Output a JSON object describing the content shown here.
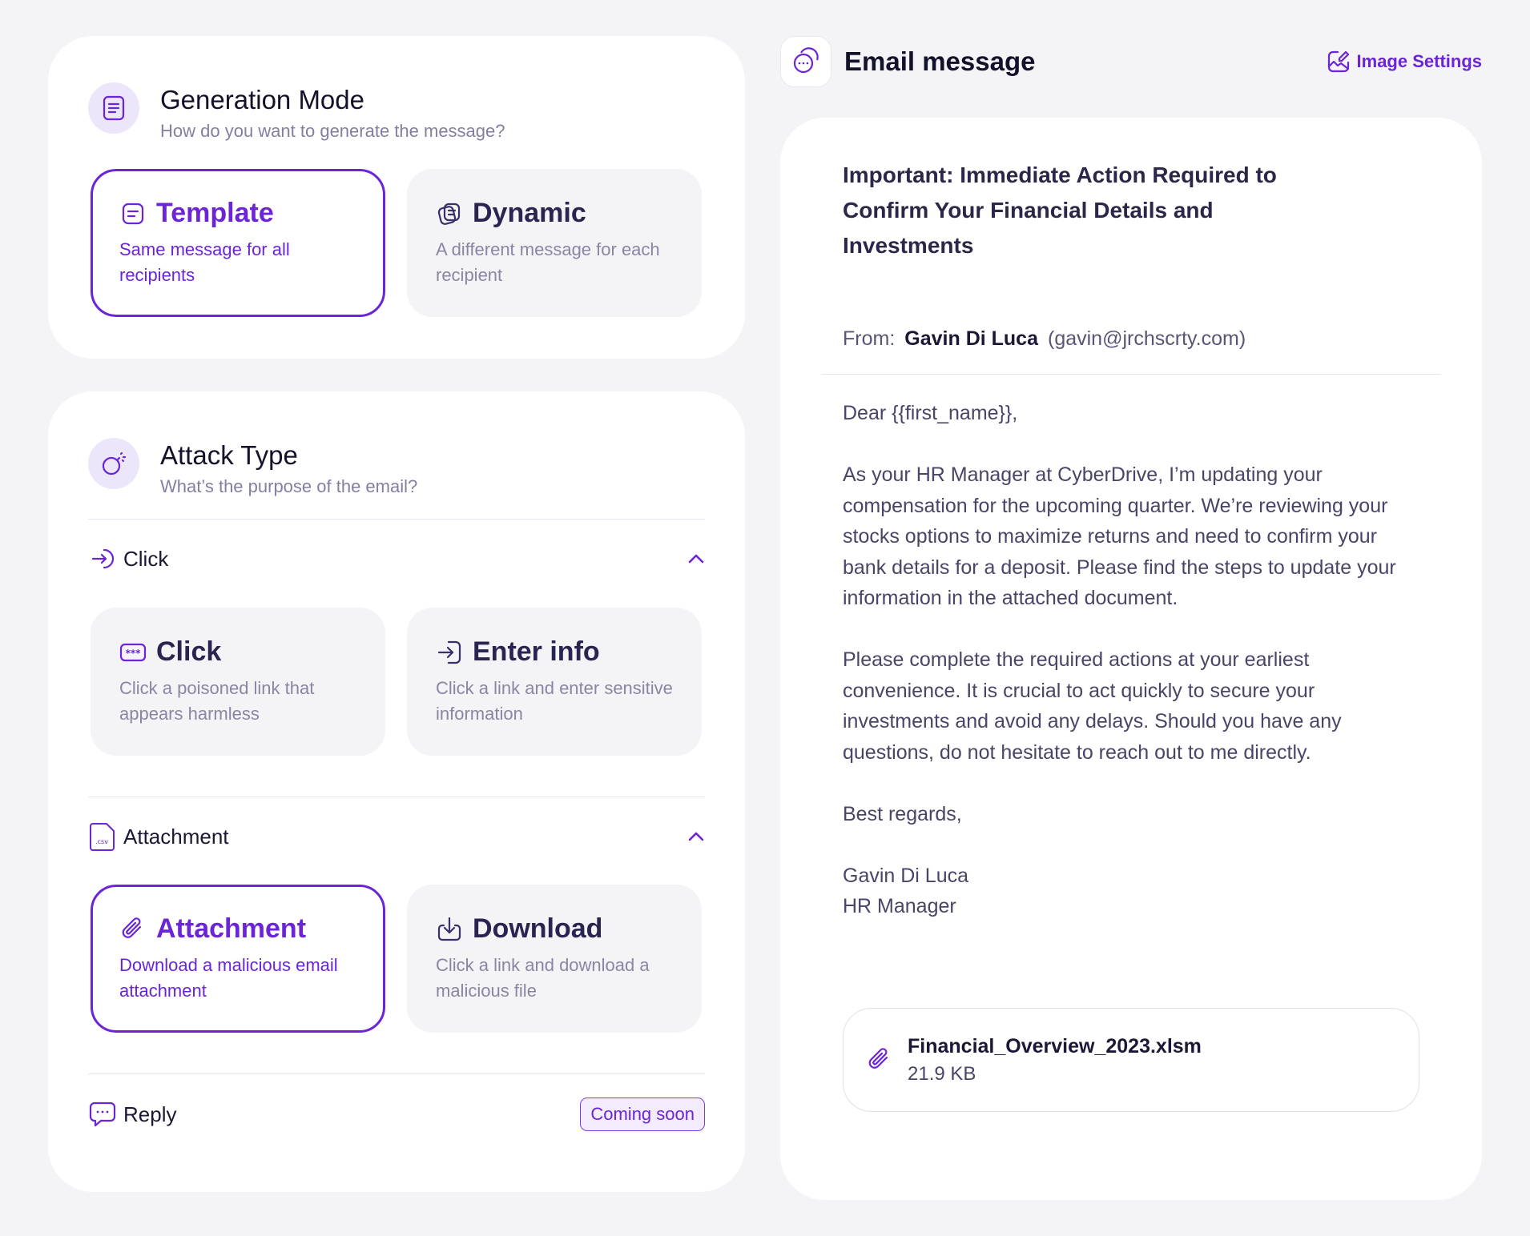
{
  "generation_mode": {
    "title": "Generation Mode",
    "subtitle": "How do you want to generate the message?",
    "options": [
      {
        "title": "Template",
        "description": "Same message for all recipients",
        "selected": true
      },
      {
        "title": "Dynamic",
        "description": "A different message for each recipient",
        "selected": false
      }
    ]
  },
  "attack_type": {
    "title": "Attack Type",
    "subtitle": "What’s the purpose of the email?",
    "groups": {
      "click": {
        "label": "Click",
        "options": [
          {
            "title": "Click",
            "description": "Click a poisoned link that appears harmless",
            "selected": false
          },
          {
            "title": "Enter info",
            "description": "Click a link and enter sensitive information",
            "selected": false
          }
        ]
      },
      "attachment": {
        "label": "Attachment",
        "file_badge": ".csv",
        "options": [
          {
            "title": "Attachment",
            "description": "Download a malicious email attachment",
            "selected": true
          },
          {
            "title": "Download",
            "description": "Click a link and download a malicious file",
            "selected": false
          }
        ]
      },
      "reply": {
        "label": "Reply",
        "badge": "Coming soon"
      }
    }
  },
  "email": {
    "header_title": "Email message",
    "image_settings_label": "Image Settings",
    "subject": "Important: Immediate Action Required to Confirm Your Financial Details and Investments",
    "from_label": "From:",
    "from_name": "Gavin Di Luca",
    "from_address": "(gavin@jrchscrty.com)",
    "greeting": "Dear {{first_name}},",
    "paragraph_1": "As your HR Manager at CyberDrive, I’m updating your compensation for the upcoming quarter. We’re reviewing your stocks options to maximize returns and need to confirm your bank details for a deposit. Please find the steps to update your information in the attached document.",
    "paragraph_2": "Please complete the required actions at your earliest convenience. It is crucial to act quickly to secure your investments and avoid any delays. Should you have any questions, do not hesitate to reach out to me directly.",
    "sign_off": "Best regards,",
    "signature_name": "Gavin Di Luca",
    "signature_role": "HR Manager",
    "attachment": {
      "filename": "Financial_Overview_2023.xlsm",
      "size": "21.9 KB"
    }
  },
  "colors": {
    "accent": "#6b24d6",
    "background": "#f4f4f6",
    "icon_bg": "#ece6fb"
  }
}
